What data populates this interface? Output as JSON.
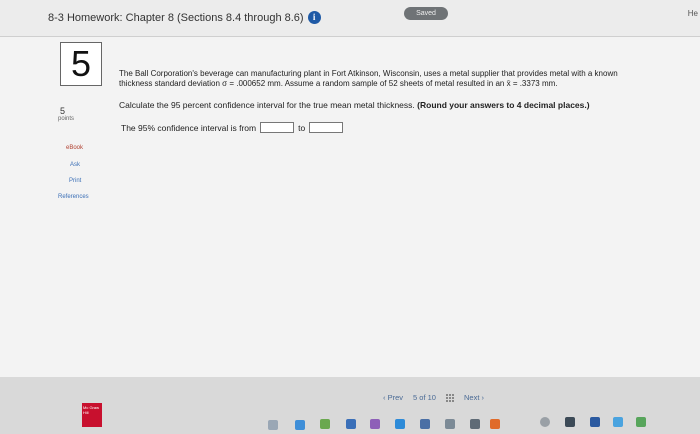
{
  "header": {
    "assignment_title": "8-3 Homework: Chapter 8 (Sections 8.4 through 8.6)",
    "saved_label": "Saved",
    "help_label": "He"
  },
  "question": {
    "number": "5",
    "points_value": "5",
    "points_label": "points",
    "text": "The Ball Corporation's beverage can manufacturing plant in Fort Atkinson, Wisconsin, uses a metal supplier that provides metal with a known thickness standard deviation σ = .000652 mm. Assume a random sample of 52 sheets of metal resulted in an x̄ = .3373 mm.",
    "instruction": "Calculate the 95 percent confidence interval for the true mean metal thickness.",
    "instruction_bold": "(Round your answers to 4 decimal places.)",
    "answer_prefix": "The 95% confidence interval is from",
    "answer_to": "to",
    "lower_value": "",
    "upper_value": ""
  },
  "sidebar": {
    "ebook": "eBook",
    "ask": "Ask",
    "print": "Print",
    "references": "References"
  },
  "footer": {
    "prev": "Prev",
    "page_current": "5",
    "page_of": "of",
    "page_total": "10",
    "next": "Next"
  },
  "logo_text": "Mc Graw Hill",
  "colors": {
    "accent_blue": "#1f5aa6",
    "link_blue": "#3b6fb6",
    "logo_red": "#c8102e"
  }
}
